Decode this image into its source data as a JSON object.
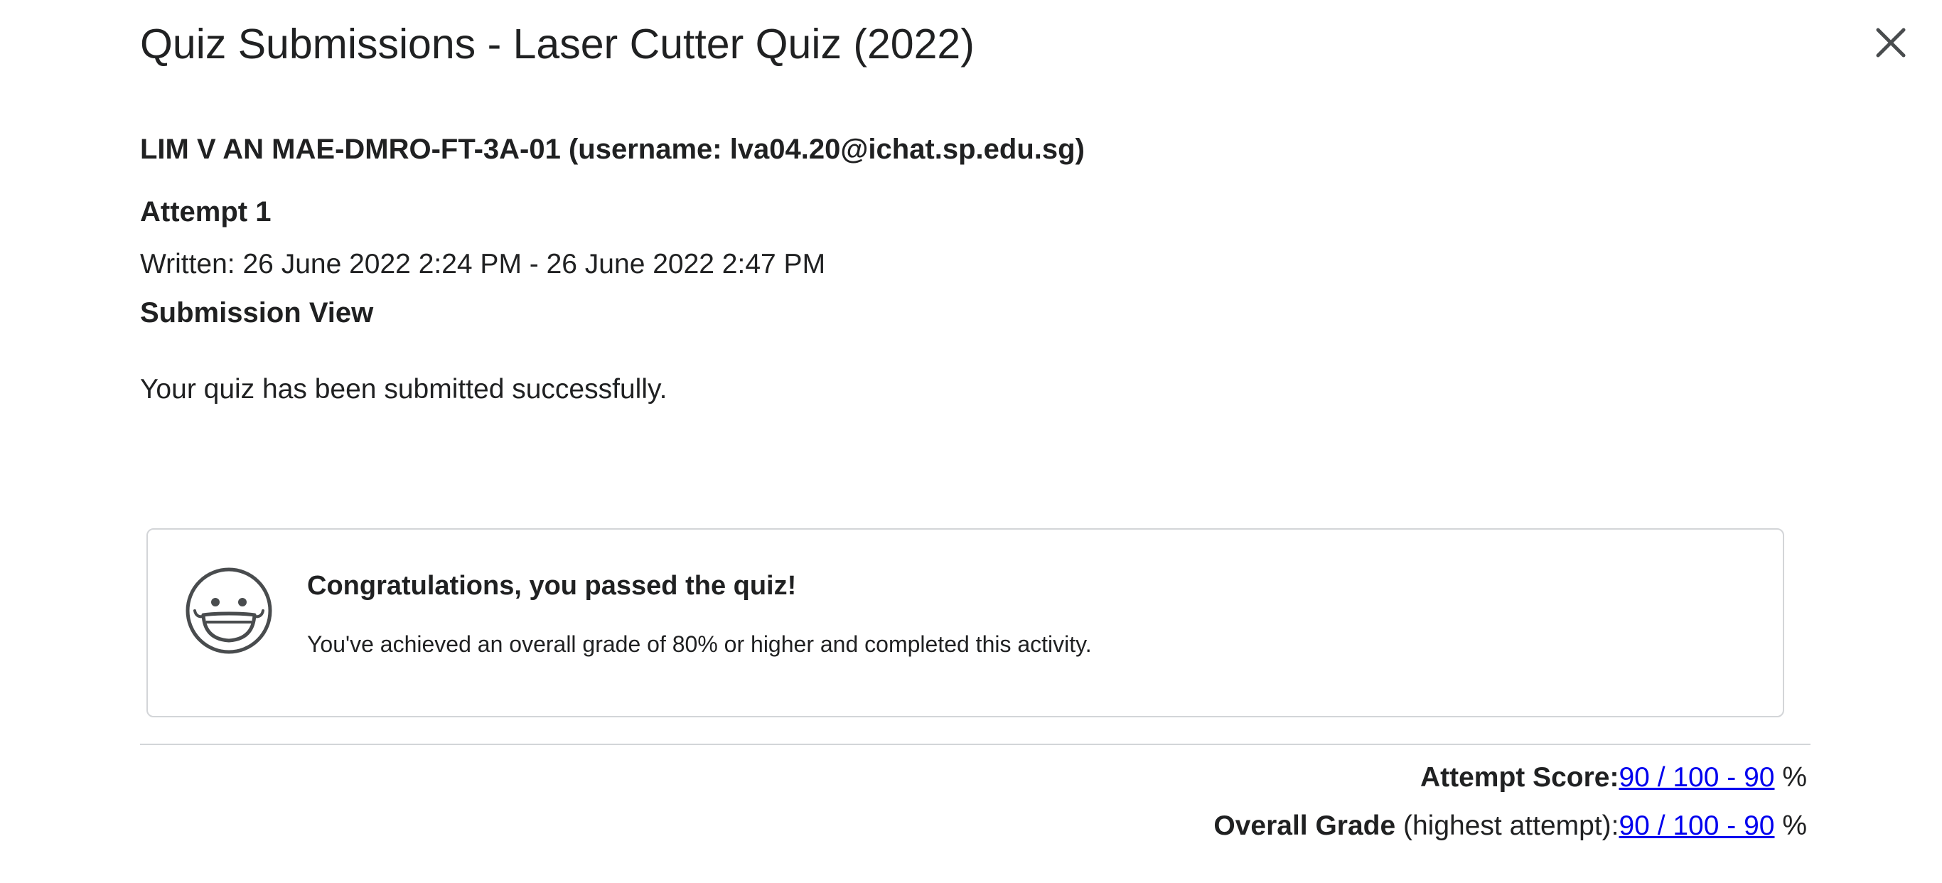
{
  "dialog": {
    "title": "Quiz Submissions - Laser Cutter Quiz (2022)",
    "close_icon": "close-icon"
  },
  "student": {
    "line": "LIM V AN MAE-DMRO-FT-3A-01 (username: lva04.20@ichat.sp.edu.sg)"
  },
  "attempt": {
    "heading": "Attempt 1",
    "written": "Written: 26 June 2022 2:24 PM - 26 June 2022 2:47 PM"
  },
  "submission": {
    "heading": "Submission View",
    "message": "Your quiz has been submitted successfully."
  },
  "pass_card": {
    "icon": "smiley-icon",
    "title": "Congratulations, you passed the quiz!",
    "text": "You've achieved an overall grade of 80% or higher and completed this activity."
  },
  "scores": {
    "attempt_label": "Attempt Score:",
    "attempt_value": "90 / 100 - 90",
    "attempt_suffix": " %",
    "overall_label": "Overall Grade",
    "overall_note": " (highest attempt):",
    "overall_value": "90 / 100 - 90",
    "overall_suffix": " %"
  },
  "colors": {
    "text": "#202122",
    "link": "#0000ee",
    "border": "#d3d5d8"
  }
}
